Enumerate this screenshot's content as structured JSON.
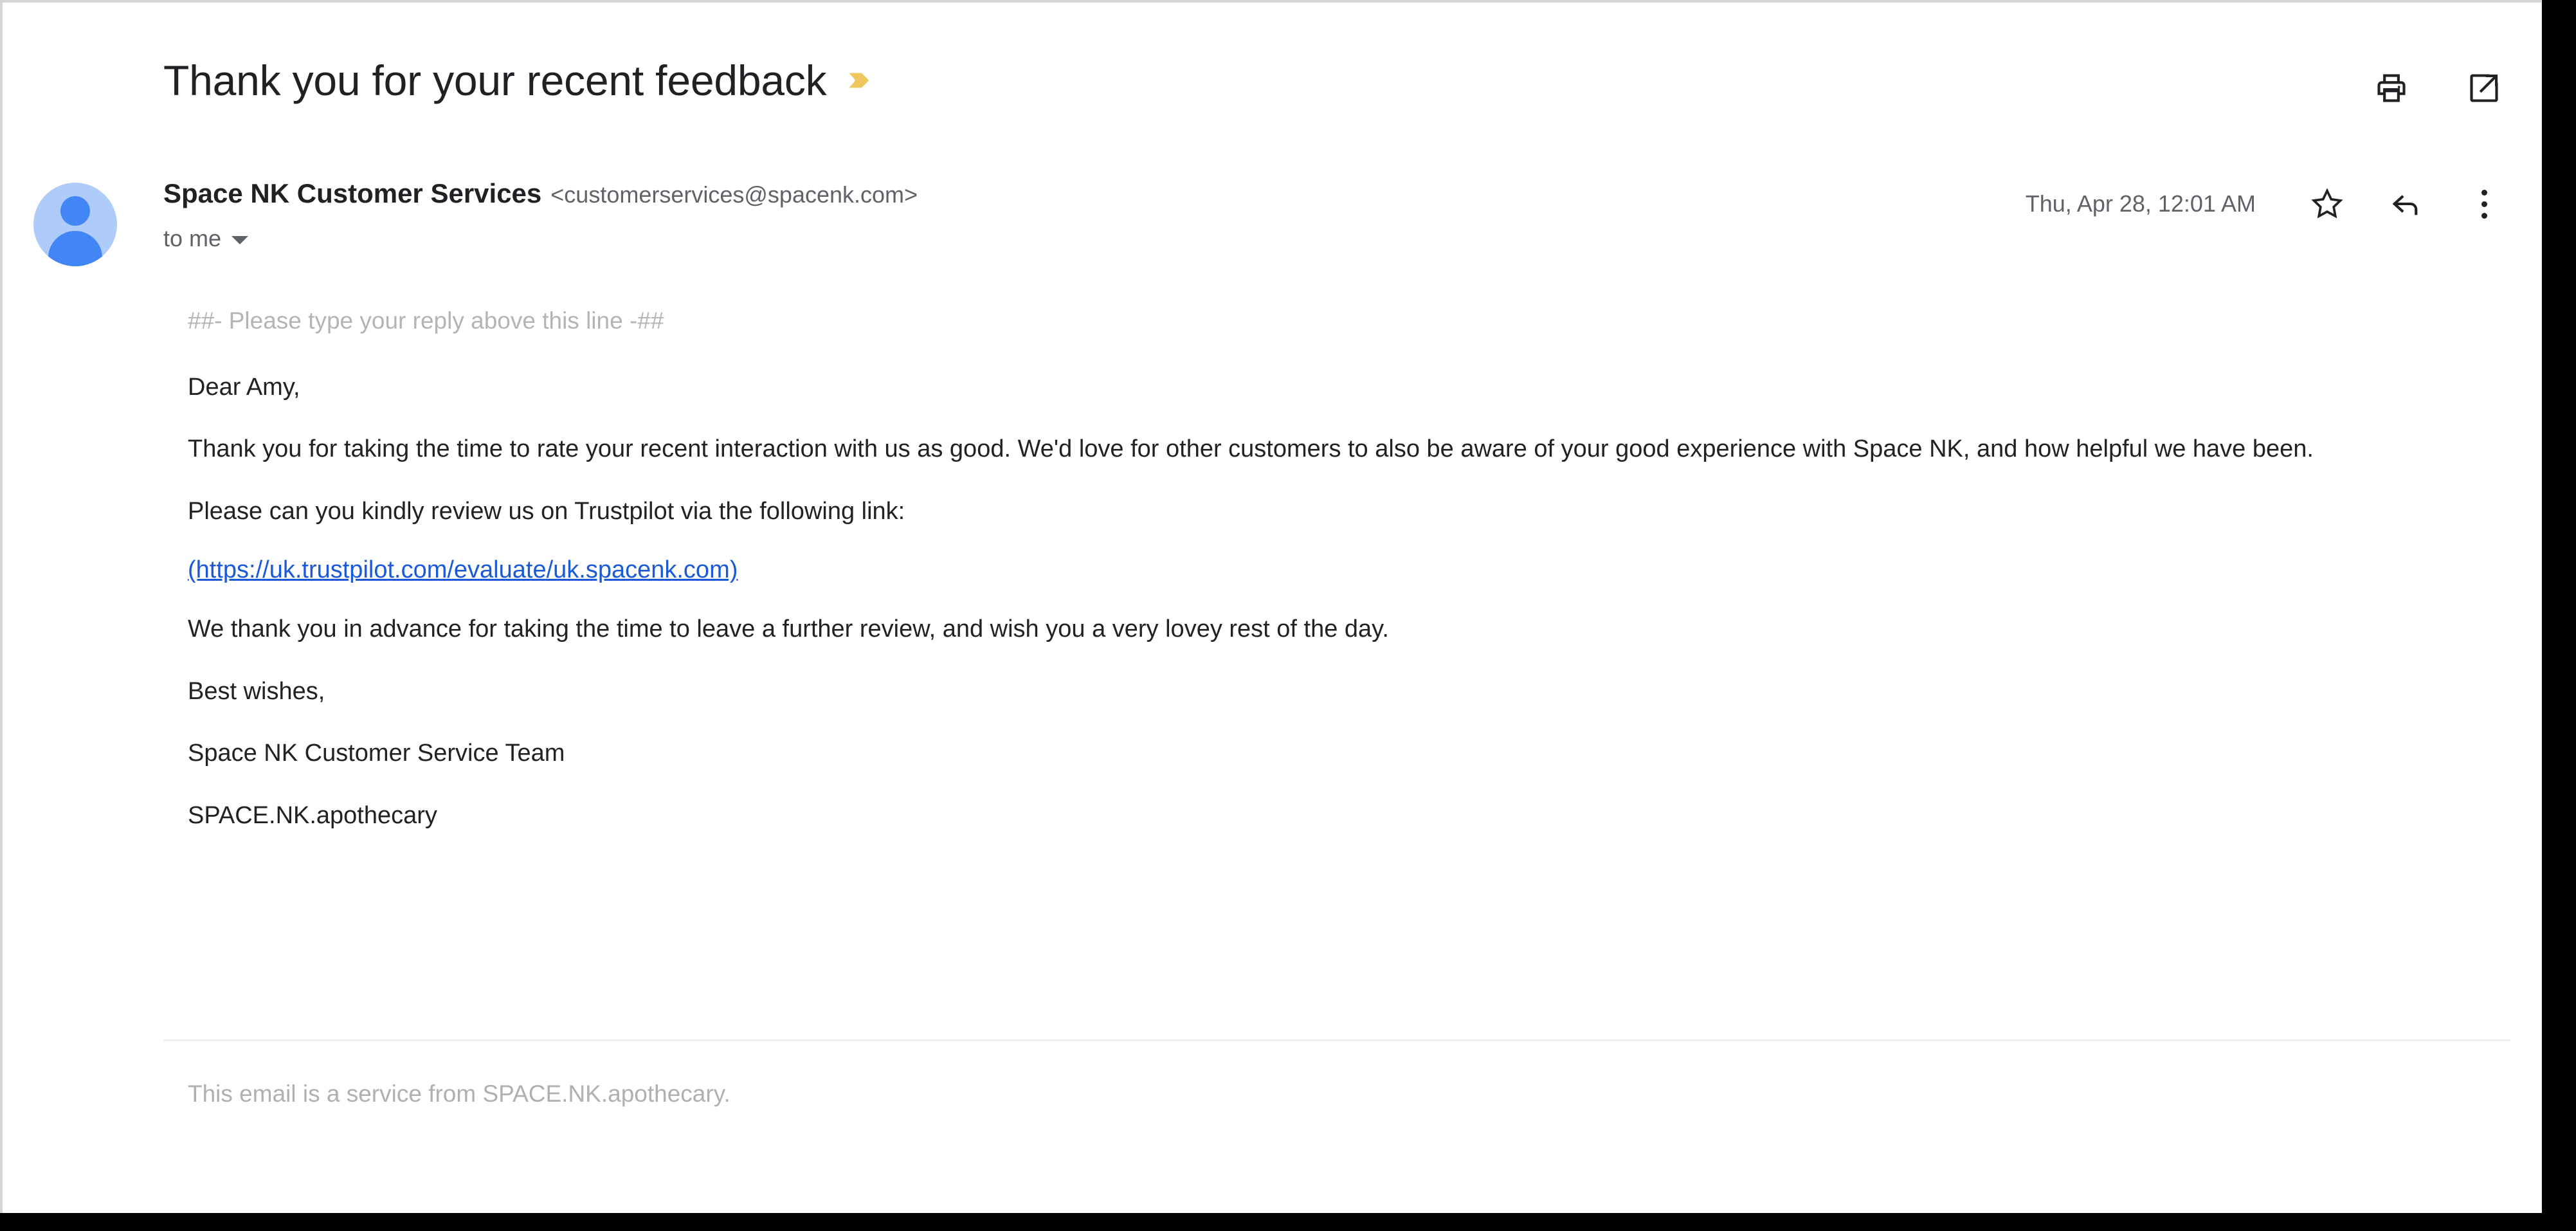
{
  "window": {
    "frame_color": "#000000",
    "pane_background": "#ffffff"
  },
  "header": {
    "subject": "Thank you for your recent feedback",
    "importance_marker": {
      "icon": "importance-chevron-icon",
      "color": "#efc75e"
    },
    "actions": [
      {
        "icon": "print-icon",
        "label": "Print all"
      },
      {
        "icon": "open-in-new-window-icon",
        "label": "Open in new window"
      }
    ]
  },
  "message": {
    "avatar": {
      "icon": "default-person-avatar",
      "background_color": "#aecbfa",
      "figure_color": "#4285f4"
    },
    "sender_name": "Space NK Customer Services",
    "sender_email": "<customerservices@spacenk.com>",
    "recipient": "to me",
    "recipient_caret": "chevron-down-icon",
    "date": "Thu, Apr 28, 12:01 AM",
    "actions": [
      {
        "icon": "star-icon",
        "label": "Not starred"
      },
      {
        "icon": "reply-icon",
        "label": "Reply"
      },
      {
        "icon": "more-options-icon",
        "label": "More"
      }
    ]
  },
  "body": {
    "reply_marker": "##- Please type your reply above this line -##",
    "greeting": "Dear Amy,",
    "paragraph_1": "Thank you for taking the time to rate your recent interaction with us as good. We'd love for other customers to also be aware of your good experience with Space NK, and how helpful we have been.",
    "paragraph_2": "Please can you kindly review us on Trustpilot via the following link:",
    "link_text": "(https://uk.trustpilot.com/evaluate/uk.spacenk.com)",
    "link_color": "#1a5ad7",
    "paragraph_3": "We thank you in advance for taking the time to leave a further review, and wish you a very lovey rest of the day.",
    "sign_off": "Best wishes,",
    "team": "Space NK Customer Service Team",
    "brand": "SPACE.NK.apothecary"
  },
  "footer": {
    "note": "This email is a service from SPACE.NK.apothecary."
  }
}
